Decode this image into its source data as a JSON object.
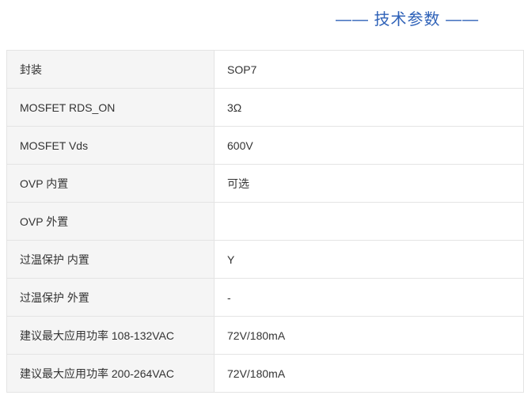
{
  "section": {
    "title": "—— 技术参数 ——"
  },
  "specs": [
    {
      "label": "封装",
      "value": "SOP7"
    },
    {
      "label": "MOSFET RDS_ON",
      "value": "3Ω"
    },
    {
      "label": "MOSFET Vds",
      "value": "600V"
    },
    {
      "label": "OVP 内置",
      "value": "可选"
    },
    {
      "label": "OVP 外置",
      "value": ""
    },
    {
      "label": "过温保护 内置",
      "value": "Y"
    },
    {
      "label": "过温保护 外置",
      "value": "-"
    },
    {
      "label": "建议最大应用功率 108-132VAC",
      "value": "72V/180mA"
    },
    {
      "label": "建议最大应用功率 200-264VAC",
      "value": "72V/180mA"
    }
  ]
}
